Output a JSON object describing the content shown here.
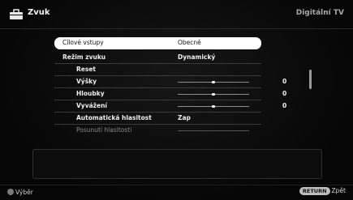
{
  "header": {
    "title": "Zvuk",
    "source": "Digitální TV",
    "icon": "toolbox-icon"
  },
  "menu": {
    "items": [
      {
        "label": "Cílové vstupy",
        "value": "Obecné",
        "selected": true
      },
      {
        "label": "Režim zvuku",
        "value": "Dynamický"
      },
      {
        "label": "Reset"
      },
      {
        "label": "Výšky",
        "slider": 0.5,
        "value_num": "0"
      },
      {
        "label": "Hloubky",
        "slider": 0.5,
        "value_num": "0"
      },
      {
        "label": "Vyvážení",
        "slider": 0.5,
        "value_num": "0"
      },
      {
        "label": "Automatická hlasitost",
        "value": "Zap"
      },
      {
        "label": "Posunutí hlasitosti",
        "slider": 0.5,
        "dim": true
      }
    ]
  },
  "footer": {
    "select_label": "Výběr",
    "return_button": "RETURN",
    "back_label": "Zpět"
  }
}
